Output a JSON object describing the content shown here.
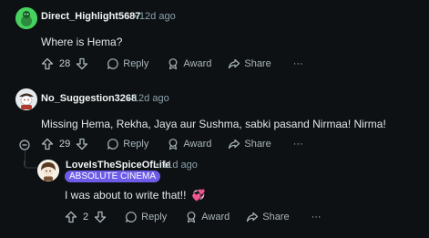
{
  "comments": [
    {
      "username": "Direct_Highlight5687",
      "separator": "•",
      "time": "12d ago",
      "body": "Where is Hema?",
      "votes": "28",
      "reply_label": "Reply",
      "award_label": "Award",
      "share_label": "Share",
      "more_label": "···"
    },
    {
      "username": "No_Suggestion3268",
      "separator": "•",
      "time": "12d ago",
      "body": "Missing Hema, Rekha, Jaya aur Sushma, sabki pasand Nirmaa! Nirma!",
      "votes": "29",
      "reply_label": "Reply",
      "award_label": "Award",
      "share_label": "Share",
      "more_label": "···"
    },
    {
      "username": "LoveIsTheSpiceOfLife",
      "separator": "•",
      "time": "11d ago",
      "flair": "ABSOLUTE CINEMA",
      "body": "I was about to write that!!",
      "emoji": "💞",
      "votes": "2",
      "reply_label": "Reply",
      "award_label": "Award",
      "share_label": "Share",
      "more_label": "···"
    }
  ],
  "collapse_symbol": "−",
  "colors": {
    "background": "#0e1113",
    "flair": "#6c5ce7",
    "username": "#f2f4f5",
    "meta": "#8ba2ad",
    "action": "#aab6bd"
  }
}
